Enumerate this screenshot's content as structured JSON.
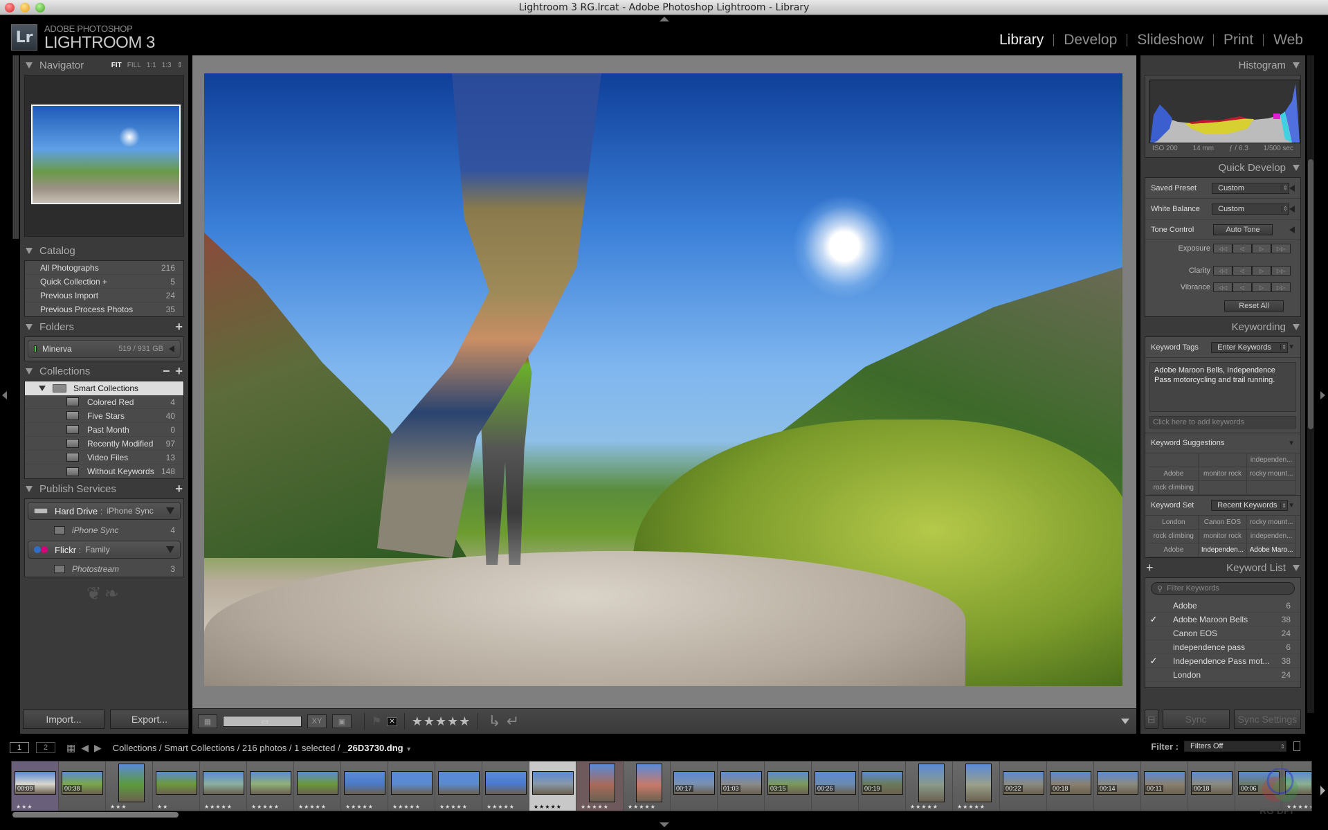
{
  "window": {
    "title": "Lightroom 3 RG.lrcat - Adobe Photoshop Lightroom - Library"
  },
  "identity": {
    "badge": "Lr",
    "line1": "ADOBE PHOTOSHOP",
    "line2": "LIGHTROOM 3"
  },
  "modules": [
    {
      "label": "Library",
      "active": true
    },
    {
      "label": "Develop"
    },
    {
      "label": "Slideshow"
    },
    {
      "label": "Print"
    },
    {
      "label": "Web"
    }
  ],
  "left": {
    "navigator": {
      "title": "Navigator",
      "zoom_options": [
        "FIT",
        "FILL",
        "1:1",
        "1:3"
      ],
      "active_zoom": "FIT"
    },
    "catalog": {
      "title": "Catalog",
      "items": [
        {
          "label": "All Photographs",
          "count": "216"
        },
        {
          "label": "Quick Collection +",
          "count": "5"
        },
        {
          "label": "Previous Import",
          "count": "24"
        },
        {
          "label": "Previous Process Photos",
          "count": "35"
        }
      ]
    },
    "folders": {
      "title": "Folders",
      "volume": {
        "name": "Minerva",
        "size": "519 / 931 GB"
      }
    },
    "collections": {
      "title": "Collections",
      "set": "Smart Collections",
      "items": [
        {
          "label": "Colored Red",
          "count": "4"
        },
        {
          "label": "Five Stars",
          "count": "40"
        },
        {
          "label": "Past Month",
          "count": "0"
        },
        {
          "label": "Recently Modified",
          "count": "97"
        },
        {
          "label": "Video Files",
          "count": "13"
        },
        {
          "label": "Without Keywords",
          "count": "148"
        }
      ]
    },
    "publish": {
      "title": "Publish Services",
      "services": [
        {
          "name": "Hard Drive",
          "sub": "iPhone Sync",
          "collection": "iPhone Sync",
          "count": "4"
        },
        {
          "name": "Flickr",
          "sub": "Family",
          "collection": "Photostream",
          "count": "3"
        }
      ]
    },
    "buttons": {
      "import": "Import...",
      "export": "Export..."
    }
  },
  "toolbar": {
    "stars": "★★★★★",
    "view_modes": [
      "grid",
      "loupe",
      "compare",
      "survey"
    ],
    "compare_label": "XY"
  },
  "right": {
    "histogram": {
      "title": "Histogram",
      "iso": "ISO 200",
      "focal": "14 mm",
      "aperture": "ƒ / 6.3",
      "shutter": "1/500 sec"
    },
    "quick_develop": {
      "title": "Quick Develop",
      "saved_preset": {
        "label": "Saved Preset",
        "value": "Custom"
      },
      "white_balance": {
        "label": "White Balance",
        "value": "Custom"
      },
      "tone_control": {
        "label": "Tone Control",
        "button": "Auto Tone"
      },
      "steppers": [
        "Exposure",
        "Clarity",
        "Vibrance"
      ],
      "reset": "Reset All"
    },
    "keywording": {
      "title": "Keywording",
      "tags_label": "Keyword Tags",
      "tags_mode": "Enter Keywords",
      "keywords_text": "Adobe Maroon Bells, Independence Pass motorcycling and trail running.",
      "add_placeholder": "Click here to add keywords",
      "suggestions_label": "Keyword Suggestions",
      "suggestions": [
        "",
        "",
        "independen...",
        "Adobe",
        "monitor rock",
        "rocky mount...",
        "rock climbing",
        "",
        ""
      ],
      "set_label": "Keyword Set",
      "set_value": "Recent Keywords",
      "set_keywords": [
        {
          "t": "London"
        },
        {
          "t": "Canon EOS"
        },
        {
          "t": "rocky mount..."
        },
        {
          "t": "rock climbing"
        },
        {
          "t": "monitor rock"
        },
        {
          "t": "independen..."
        },
        {
          "t": "Adobe"
        },
        {
          "t": "Independen...",
          "hi": true
        },
        {
          "t": "Adobe Maro...",
          "hi": true
        }
      ]
    },
    "keyword_list": {
      "title": "Keyword List",
      "filter_placeholder": "Filter Keywords",
      "items": [
        {
          "label": "Adobe",
          "count": "6",
          "checked": false
        },
        {
          "label": "Adobe Maroon Bells",
          "count": "38",
          "checked": true
        },
        {
          "label": "Canon EOS",
          "count": "24",
          "checked": false
        },
        {
          "label": "independence pass",
          "count": "6",
          "checked": false
        },
        {
          "label": "Independence Pass mot...",
          "count": "38",
          "checked": true
        },
        {
          "label": "London",
          "count": "24",
          "checked": false
        }
      ]
    },
    "sync": {
      "sync": "Sync",
      "settings": "Sync Settings"
    }
  },
  "filmstrip": {
    "screens": [
      "1",
      "2"
    ],
    "breadcrumb_path": "Collections / Smart Collections / 216 photos / 1 selected / ",
    "breadcrumb_file": "_26D3730.dng",
    "filter_label": "Filter :",
    "filter_value": "Filters Off",
    "cells": [
      {
        "dur": "00:09",
        "stars": "★★★",
        "state": "purple",
        "color": "#d9d6cc"
      },
      {
        "dur": "00:38",
        "stars": "",
        "color": "#7aa84a"
      },
      {
        "dur": "",
        "stars": "★★★",
        "port": true,
        "color": "#5c9a3a"
      },
      {
        "dur": "",
        "stars": "★★",
        "color": "#6c9a3a"
      },
      {
        "dur": "",
        "stars": "★★★★★",
        "color": "#8ab0a0"
      },
      {
        "dur": "",
        "stars": "★★★★★",
        "color": "#90b078"
      },
      {
        "dur": "",
        "stars": "★★★★★",
        "color": "#6a9a3a"
      },
      {
        "dur": "",
        "stars": "★★★★★",
        "color": "#4a7ac8"
      },
      {
        "dur": "",
        "stars": "★★★★★",
        "color": "#5a8ad0"
      },
      {
        "dur": "",
        "stars": "★★★★★",
        "color": "#5a8ad0"
      },
      {
        "dur": "",
        "stars": "★★★★★",
        "color": "#4a7ad0"
      },
      {
        "dur": "",
        "stars": "★★★★★",
        "state": "selected",
        "color": "#8898a8"
      },
      {
        "dur": "",
        "stars": "★★★★★",
        "state": "rose",
        "port": true,
        "color": "#a86a5a"
      },
      {
        "dur": "",
        "stars": "★★★★★",
        "port": true,
        "color": "#c87a6a"
      },
      {
        "dur": "00:17",
        "stars": "",
        "color": "#7a90b0"
      },
      {
        "dur": "01:03",
        "stars": "",
        "color": "#8a8a8a"
      },
      {
        "dur": "03:15",
        "stars": "",
        "color": "#7a9a5a"
      },
      {
        "dur": "00:26",
        "stars": "",
        "color": "#6a8ab0"
      },
      {
        "dur": "00:19",
        "stars": "",
        "color": "#6a7a5a"
      },
      {
        "dur": "",
        "stars": "★★★★★",
        "port": true,
        "color": "#8a9a8a"
      },
      {
        "dur": "",
        "stars": "★★★★★",
        "port": true,
        "color": "#9aa08a"
      },
      {
        "dur": "00:22",
        "stars": "",
        "color": "#8a8a80"
      },
      {
        "dur": "00:18",
        "stars": "",
        "color": "#8a8070"
      },
      {
        "dur": "00:14",
        "stars": "",
        "color": "#8a8a80"
      },
      {
        "dur": "00:11",
        "stars": "",
        "color": "#8a8070"
      },
      {
        "dur": "00:18",
        "stars": "",
        "color": "#8a8a80"
      },
      {
        "dur": "00:06",
        "stars": "",
        "color": "#6a7a6a"
      },
      {
        "dur": "",
        "stars": "★★★★★",
        "color": "#8ab090"
      }
    ]
  },
  "watermark": "RG DPI"
}
